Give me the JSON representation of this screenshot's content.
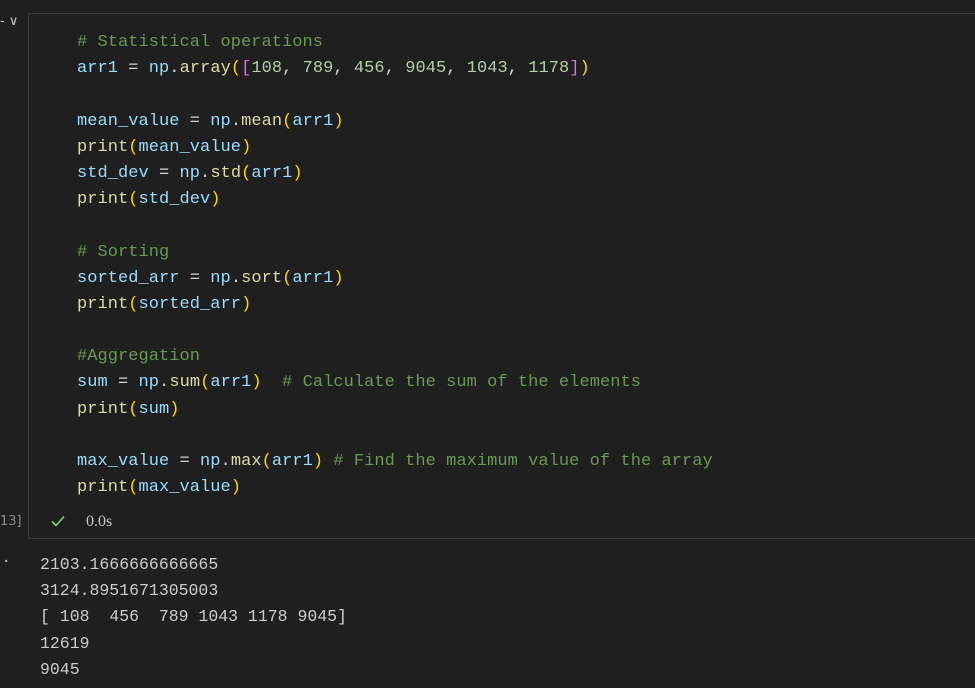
{
  "gutter": {
    "collapse_glyph": "- ∨",
    "exec_count": "13]",
    "output_marker": "·"
  },
  "code": [
    [
      {
        "t": "# Statistical operations",
        "c": "cm"
      }
    ],
    [
      {
        "t": "arr1",
        "c": "v"
      },
      {
        "t": " = ",
        "c": "op"
      },
      {
        "t": "np",
        "c": "v"
      },
      {
        "t": ".",
        "c": "op"
      },
      {
        "t": "array",
        "c": "f"
      },
      {
        "t": "(",
        "c": "p1"
      },
      {
        "t": "[",
        "c": "p2"
      },
      {
        "t": "108",
        "c": "n"
      },
      {
        "t": ", ",
        "c": "op"
      },
      {
        "t": "789",
        "c": "n"
      },
      {
        "t": ", ",
        "c": "op"
      },
      {
        "t": "456",
        "c": "n"
      },
      {
        "t": ", ",
        "c": "op"
      },
      {
        "t": "9045",
        "c": "n"
      },
      {
        "t": ", ",
        "c": "op"
      },
      {
        "t": "1043",
        "c": "n"
      },
      {
        "t": ", ",
        "c": "op"
      },
      {
        "t": "1178",
        "c": "n"
      },
      {
        "t": "]",
        "c": "p2"
      },
      {
        "t": ")",
        "c": "p1"
      }
    ],
    [],
    [
      {
        "t": "mean_value",
        "c": "v"
      },
      {
        "t": " = ",
        "c": "op"
      },
      {
        "t": "np",
        "c": "v"
      },
      {
        "t": ".",
        "c": "op"
      },
      {
        "t": "mean",
        "c": "f"
      },
      {
        "t": "(",
        "c": "p1"
      },
      {
        "t": "arr1",
        "c": "v"
      },
      {
        "t": ")",
        "c": "p1"
      }
    ],
    [
      {
        "t": "print",
        "c": "f"
      },
      {
        "t": "(",
        "c": "p1"
      },
      {
        "t": "mean_value",
        "c": "v"
      },
      {
        "t": ")",
        "c": "p1"
      }
    ],
    [
      {
        "t": "std_dev",
        "c": "v"
      },
      {
        "t": " = ",
        "c": "op"
      },
      {
        "t": "np",
        "c": "v"
      },
      {
        "t": ".",
        "c": "op"
      },
      {
        "t": "std",
        "c": "f"
      },
      {
        "t": "(",
        "c": "p1"
      },
      {
        "t": "arr1",
        "c": "v"
      },
      {
        "t": ")",
        "c": "p1"
      }
    ],
    [
      {
        "t": "print",
        "c": "f"
      },
      {
        "t": "(",
        "c": "p1"
      },
      {
        "t": "std_dev",
        "c": "v"
      },
      {
        "t": ")",
        "c": "p1"
      }
    ],
    [],
    [
      {
        "t": "# Sorting",
        "c": "cm"
      }
    ],
    [
      {
        "t": "sorted_arr",
        "c": "v"
      },
      {
        "t": " = ",
        "c": "op"
      },
      {
        "t": "np",
        "c": "v"
      },
      {
        "t": ".",
        "c": "op"
      },
      {
        "t": "sort",
        "c": "f"
      },
      {
        "t": "(",
        "c": "p1"
      },
      {
        "t": "arr1",
        "c": "v"
      },
      {
        "t": ")",
        "c": "p1"
      }
    ],
    [
      {
        "t": "print",
        "c": "f"
      },
      {
        "t": "(",
        "c": "p1"
      },
      {
        "t": "sorted_arr",
        "c": "v"
      },
      {
        "t": ")",
        "c": "p1"
      }
    ],
    [],
    [
      {
        "t": "#Aggregation",
        "c": "cm"
      }
    ],
    [
      {
        "t": "sum",
        "c": "v"
      },
      {
        "t": " = ",
        "c": "op"
      },
      {
        "t": "np",
        "c": "v"
      },
      {
        "t": ".",
        "c": "op"
      },
      {
        "t": "sum",
        "c": "f"
      },
      {
        "t": "(",
        "c": "p1"
      },
      {
        "t": "arr1",
        "c": "v"
      },
      {
        "t": ")",
        "c": "p1"
      },
      {
        "t": "  ",
        "c": "op"
      },
      {
        "t": "# Calculate the sum of the elements",
        "c": "cm"
      }
    ],
    [
      {
        "t": "print",
        "c": "f"
      },
      {
        "t": "(",
        "c": "p1"
      },
      {
        "t": "sum",
        "c": "v"
      },
      {
        "t": ")",
        "c": "p1"
      }
    ],
    [],
    [
      {
        "t": "max_value",
        "c": "v"
      },
      {
        "t": " = ",
        "c": "op"
      },
      {
        "t": "np",
        "c": "v"
      },
      {
        "t": ".",
        "c": "op"
      },
      {
        "t": "max",
        "c": "f"
      },
      {
        "t": "(",
        "c": "p1"
      },
      {
        "t": "arr1",
        "c": "v"
      },
      {
        "t": ")",
        "c": "p1"
      },
      {
        "t": " ",
        "c": "op"
      },
      {
        "t": "# Find the maximum value of the array",
        "c": "cm"
      }
    ],
    [
      {
        "t": "print",
        "c": "f"
      },
      {
        "t": "(",
        "c": "p1"
      },
      {
        "t": "max_value",
        "c": "v"
      },
      {
        "t": ")",
        "c": "p1"
      }
    ]
  ],
  "status": {
    "icon": "check-icon",
    "duration": "0.0s",
    "success_color": "#89d185"
  },
  "output": [
    "2103.1666666666665",
    "3124.8951671305003",
    "[ 108  456  789 1043 1178 9045]",
    "12619",
    "9045"
  ]
}
